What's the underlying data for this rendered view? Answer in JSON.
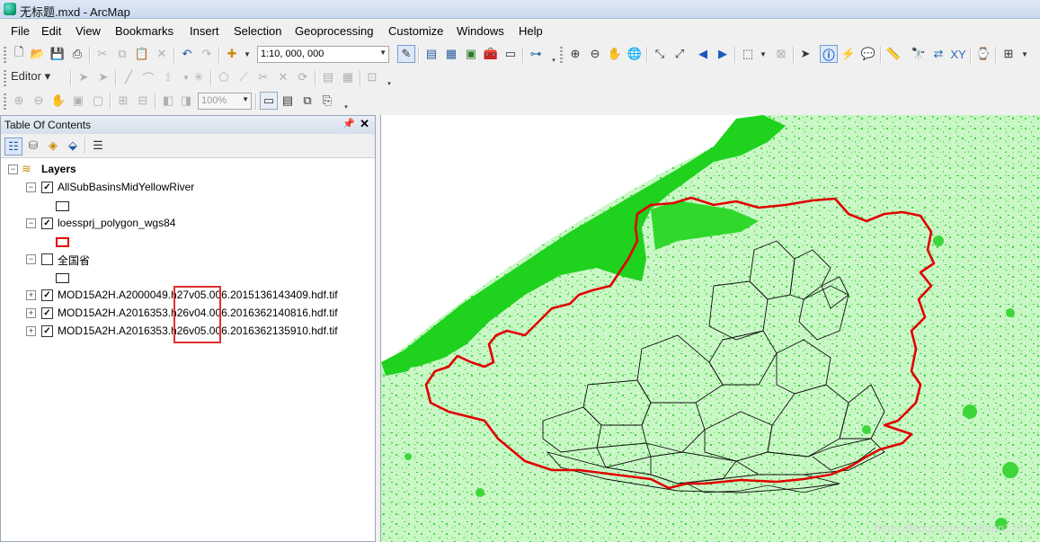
{
  "window": {
    "title": "无标题.mxd - ArcMap"
  },
  "menu": [
    "File",
    "Edit",
    "View",
    "Bookmarks",
    "Insert",
    "Selection",
    "Geoprocessing",
    "Customize",
    "Windows",
    "Help"
  ],
  "toolbar": {
    "scale": "1:10, 000, 000",
    "editor_label": "Editor ▾",
    "zoom_level": "100%"
  },
  "toc": {
    "title": "Table Of Contents",
    "root": "Layers",
    "layers": [
      {
        "name": "AllSubBasinsMidYellowRiver",
        "checked": true
      },
      {
        "name": "loessprj_polygon_wgs84",
        "checked": true
      },
      {
        "name": "全国省",
        "checked": false
      },
      {
        "name": "MOD15A2H.A2000049.h27v05.006.2015136143409.hdf.tif",
        "checked": true
      },
      {
        "name": "MOD15A2H.A2016353.h26v04.006.2016362140816.hdf.tif",
        "checked": true
      },
      {
        "name": "MOD15A2H.A2016353.h26v05.006.2016362135910.hdf.tif",
        "checked": true
      }
    ]
  },
  "map": {
    "watermark": "https://blog.csdn.net/fyan1201"
  },
  "colors": {
    "raster_light": "#c8f7c5",
    "raster_dark": "#1ed21e",
    "boundary": "#e00000",
    "highlight": "#e03030"
  }
}
